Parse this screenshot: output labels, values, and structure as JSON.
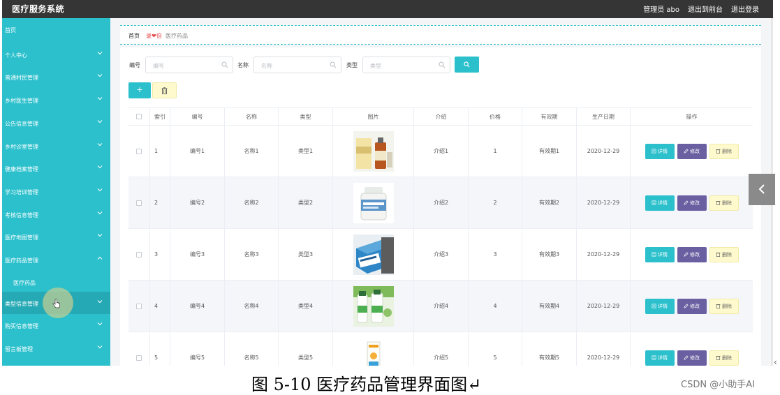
{
  "app": {
    "title": "医疗服务系统"
  },
  "topbar": {
    "user": "管理员 abo",
    "front": "退出到前台",
    "logout": "退出登录"
  },
  "sidebar": {
    "items": [
      {
        "label": "首页",
        "chevron": false
      },
      {
        "label": "个人中心",
        "chevron": true
      },
      {
        "label": "普通村民管理",
        "chevron": true
      },
      {
        "label": "乡村医生管理",
        "chevron": true
      },
      {
        "label": "公告信息管理",
        "chevron": true
      },
      {
        "label": "乡村诊室管理",
        "chevron": true
      },
      {
        "label": "健康档案管理",
        "chevron": true
      },
      {
        "label": "学习培训管理",
        "chevron": true
      },
      {
        "label": "考核信息管理",
        "chevron": true
      },
      {
        "label": "医疗地图管理",
        "chevron": true
      },
      {
        "label": "医疗药品管理",
        "chevron": true,
        "expanded": true
      },
      {
        "label": "医疗药品",
        "chevron": false,
        "sub": true
      },
      {
        "label": "类型信息管理",
        "chevron": true,
        "hover": true
      },
      {
        "label": "购买信息管理",
        "chevron": true
      },
      {
        "label": "留言板管理",
        "chevron": true
      }
    ]
  },
  "breadcrumb": {
    "home": "首页",
    "mid": "录❤倍",
    "current": "医疗药品"
  },
  "search": {
    "fields": [
      {
        "label": "编号",
        "placeholder": "编号"
      },
      {
        "label": "名称",
        "placeholder": "名称"
      },
      {
        "label": "类型",
        "placeholder": "类型"
      }
    ]
  },
  "toolbar": {
    "add": "+"
  },
  "table": {
    "columns": [
      "索引",
      "编号",
      "名称",
      "类型",
      "图片",
      "介绍",
      "价格",
      "有效期",
      "生产日期",
      "操作"
    ],
    "rows": [
      {
        "index": "1",
        "code": "编号1",
        "name": "名称1",
        "type": "类型1",
        "intro": "介绍1",
        "price": "1",
        "validity": "有效期1",
        "date": "2020-12-29"
      },
      {
        "index": "2",
        "code": "编号2",
        "name": "名称2",
        "type": "类型2",
        "intro": "介绍2",
        "price": "2",
        "validity": "有效期2",
        "date": "2020-12-29"
      },
      {
        "index": "3",
        "code": "编号3",
        "name": "名称3",
        "type": "类型3",
        "intro": "介绍3",
        "price": "3",
        "validity": "有效期3",
        "date": "2020-12-29"
      },
      {
        "index": "4",
        "code": "编号4",
        "name": "名称4",
        "type": "类型4",
        "intro": "介绍4",
        "price": "4",
        "validity": "有效期4",
        "date": "2020-12-29"
      },
      {
        "index": "5",
        "code": "编号5",
        "name": "名称5",
        "type": "类型5",
        "intro": "介绍5",
        "price": "5",
        "validity": "有效期5",
        "date": "2020-12-29"
      }
    ],
    "actions": {
      "detail": "详情",
      "edit": "修改",
      "delete": "删除"
    }
  },
  "caption": "图 5-10 医疗药品管理界面图↵",
  "watermark": "CSDN @小助手AI",
  "colors": {
    "accent": "#2bc0cc",
    "topbar": "#353535",
    "edit": "#6a5fa1",
    "delete": "#fffacd",
    "crumb_red": "#e6454a"
  }
}
